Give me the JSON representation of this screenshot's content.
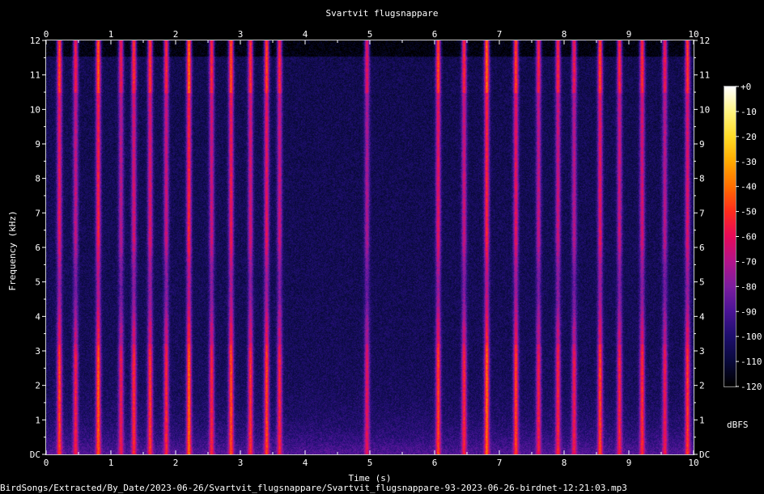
{
  "chart_data": {
    "type": "heatmap",
    "title": "Svartvit flugsnappare",
    "xlabel": "Time (s)",
    "ylabel": "Frequency (kHz)",
    "xlim": [
      0,
      10
    ],
    "ylim": [
      0,
      12
    ],
    "x_ticks": [
      "0",
      "1",
      "2",
      "3",
      "4",
      "5",
      "6",
      "7",
      "8",
      "9",
      "10"
    ],
    "y_ticks": [
      "DC",
      "1",
      "2",
      "3",
      "4",
      "5",
      "6",
      "7",
      "8",
      "9",
      "10",
      "11",
      "12"
    ],
    "colorbar": {
      "label": "dBFS",
      "range": [
        -120,
        0
      ],
      "ticks": [
        "+0",
        "-10",
        "-20",
        "-30",
        "-40",
        "-50",
        "-60",
        "-70",
        "-80",
        "-90",
        "-100",
        "-110",
        "-120"
      ],
      "colors": [
        "#000000",
        "#0a0a3c",
        "#1e0f6e",
        "#4b1496",
        "#7d1ea0",
        "#b4148c",
        "#e60a5a",
        "#ff2d1e",
        "#ff6e00",
        "#ffaa00",
        "#ffdc28",
        "#fff582",
        "#ffffff"
      ]
    },
    "calls": [
      {
        "t": 0.2,
        "dB": -72
      },
      {
        "t": 0.45,
        "dB": -80
      },
      {
        "t": 0.8,
        "dB": -68
      },
      {
        "t": 1.15,
        "dB": -82
      },
      {
        "t": 1.35,
        "dB": -76
      },
      {
        "t": 1.6,
        "dB": -74
      },
      {
        "t": 1.85,
        "dB": -78
      },
      {
        "t": 2.2,
        "dB": -66
      },
      {
        "t": 2.55,
        "dB": -78
      },
      {
        "t": 2.85,
        "dB": -70
      },
      {
        "t": 3.15,
        "dB": -76
      },
      {
        "t": 3.4,
        "dB": -72
      },
      {
        "t": 3.6,
        "dB": -78
      },
      {
        "t": 4.95,
        "dB": -84
      },
      {
        "t": 6.05,
        "dB": -72
      },
      {
        "t": 6.45,
        "dB": -78
      },
      {
        "t": 6.8,
        "dB": -66
      },
      {
        "t": 7.25,
        "dB": -72
      },
      {
        "t": 7.6,
        "dB": -80
      },
      {
        "t": 7.9,
        "dB": -78
      },
      {
        "t": 8.15,
        "dB": -82
      },
      {
        "t": 8.55,
        "dB": -72
      },
      {
        "t": 8.85,
        "dB": -78
      },
      {
        "t": 9.2,
        "dB": -76
      },
      {
        "t": 9.55,
        "dB": -82
      },
      {
        "t": 9.9,
        "dB": -74
      }
    ]
  },
  "footer_path": "BirdSongs/Extracted/By_Date/2023-06-26/Svartvit_flugsnappare/Svartvit_flugsnappare-93-2023-06-26-birdnet-12:21:03.mp3"
}
